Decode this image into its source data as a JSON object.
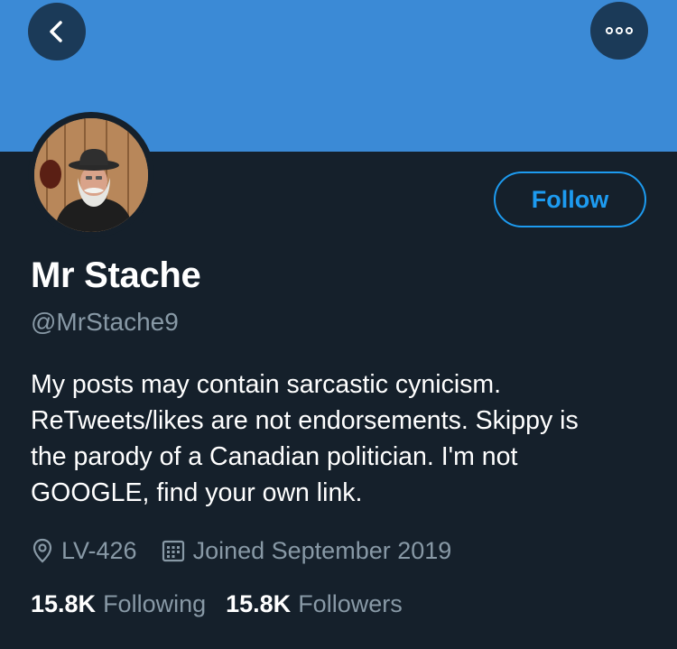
{
  "colors": {
    "banner": "#3b8ad6",
    "background": "#15202b",
    "accent": "#1d9bf0",
    "secondary_text": "#8899a6"
  },
  "header": {
    "back_icon": "chevron-left-icon",
    "more_icon": "more-dots-icon"
  },
  "profile": {
    "name": "Mr Stache",
    "handle": "@MrStache9",
    "follow_label": "Follow",
    "bio_lines": [
      "My posts may contain sarcastic cynicism.",
      "ReTweets/likes are not endorsements. Skippy is",
      "the parody of a Canadian politician. I'm not",
      "GOOGLE, find your own link."
    ],
    "location": "LV-426",
    "location_icon": "location-pin-icon",
    "joined": "Joined September 2019",
    "joined_icon": "calendar-icon"
  },
  "stats": {
    "following_count": "15.8K",
    "following_label": "Following",
    "followers_count": "15.8K",
    "followers_label": "Followers"
  }
}
